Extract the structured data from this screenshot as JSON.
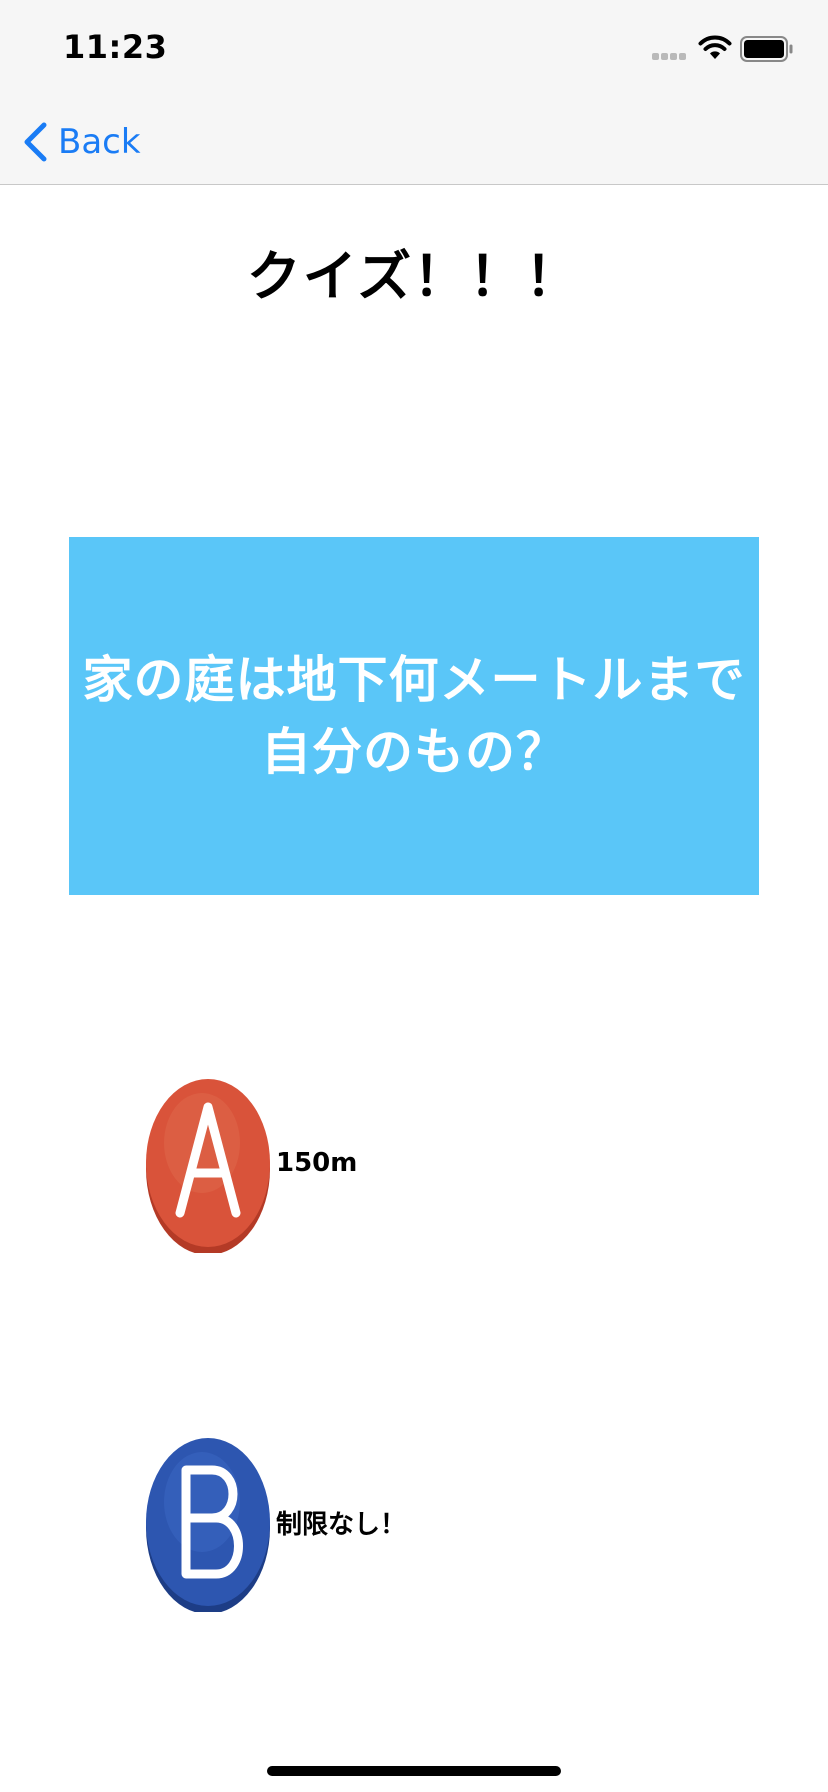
{
  "status_bar": {
    "time": "11:23"
  },
  "nav": {
    "back_label": "Back",
    "accent_color": "#1a7cf5"
  },
  "quiz": {
    "title": "クイズ！！！",
    "question": "家の庭は地下何メートルまで自分のもの？",
    "question_bg_color": "#5ac6f8",
    "answers": [
      {
        "letter": "A",
        "label": "150m",
        "badge_color": "#d9533a"
      },
      {
        "letter": "B",
        "label": "制限なし！",
        "badge_color": "#2d56b0"
      }
    ]
  }
}
